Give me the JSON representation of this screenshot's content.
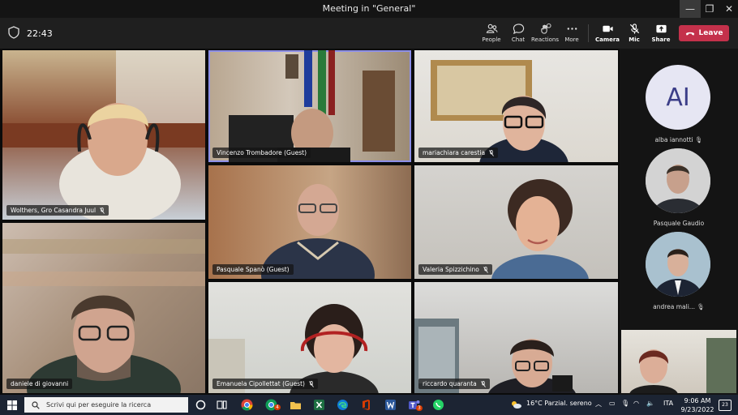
{
  "window": {
    "title": "Meeting in \"General\"",
    "minimize": "—",
    "restore": "❐",
    "close": "✕"
  },
  "toolbar": {
    "timer": "22:43",
    "people": "People",
    "chat": "Chat",
    "reactions": "Reactions",
    "more": "More",
    "camera": "Camera",
    "mic": "Mic",
    "share": "Share",
    "leave": "Leave"
  },
  "participants": [
    {
      "name": "Wolthers, Gro Casandra Juul"
    },
    {
      "name": "Vincenzo Trombadore (Guest)"
    },
    {
      "name": "mariachiara carestia"
    },
    {
      "name": "Pasquale Spanò (Guest)"
    },
    {
      "name": "Valeria Spizzichino"
    },
    {
      "name": "daniele di giovanni"
    },
    {
      "name": "Emanuela Cipollettat (Guest)"
    },
    {
      "name": "riccardo quaranta"
    }
  ],
  "sidebar": [
    {
      "initials": "AI",
      "name": "alba iannotti"
    },
    {
      "name": "Pasquale Gaudio"
    },
    {
      "name": "andrea mali..."
    }
  ],
  "taskbar": {
    "search_placeholder": "Scrivi qui per eseguire la ricerca",
    "badge_chrome": "4",
    "badge_teams": "3",
    "weather": "16°C  Parzial. sereno",
    "language": "ITA",
    "time": "9:06 AM",
    "date": "9/23/2022",
    "notifications": "23"
  },
  "colors": {
    "leave": "#c4314b",
    "active_border": "#8d8fe8",
    "taskbar": "#1c2433"
  }
}
